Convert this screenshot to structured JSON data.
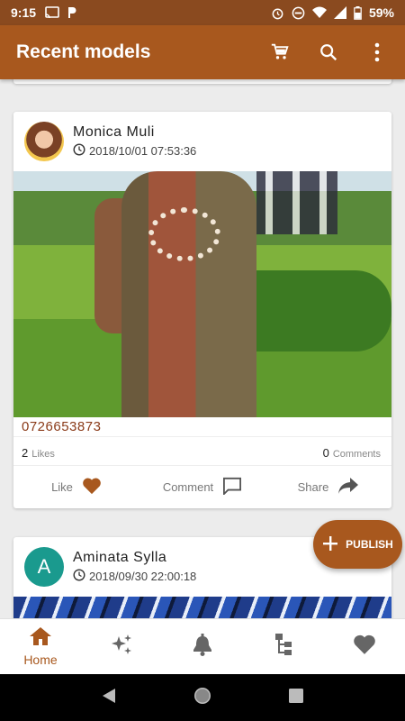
{
  "status_bar": {
    "time": "9:15",
    "battery": "59%",
    "left_icons": [
      "cast-icon",
      "p-app-icon"
    ],
    "right_icons": [
      "alarm-icon",
      "dnd-icon",
      "wifi-icon",
      "signal-icon",
      "battery-icon"
    ]
  },
  "app_bar": {
    "title": "Recent models",
    "actions": [
      "cart-icon",
      "search-icon",
      "more-vert-icon"
    ]
  },
  "posts": [
    {
      "author": "Monica Muli",
      "date": "2018/10/01 07:53:36",
      "phone": "0726653873",
      "likes_count": "2",
      "likes_label": "Likes",
      "comments_count": "0",
      "comments_label": "Comments",
      "actions": {
        "like": "Like",
        "comment": "Comment",
        "share": "Share"
      }
    },
    {
      "author": "Aminata Sylla",
      "avatar_letter": "A",
      "date": "2018/09/30 22:00:18"
    }
  ],
  "fab": {
    "label": "PUBLISH"
  },
  "bottom_nav": {
    "items": [
      {
        "icon": "home-icon",
        "label": "Home",
        "active": true
      },
      {
        "icon": "sparkles-icon"
      },
      {
        "icon": "bell-icon"
      },
      {
        "icon": "tree-icon"
      },
      {
        "icon": "heart-icon"
      }
    ]
  },
  "colors": {
    "status_bar": "#8a4a1f",
    "primary": "#a8581e",
    "phone_text": "#8a3a18",
    "avatar_teal": "#1a9a8e"
  }
}
